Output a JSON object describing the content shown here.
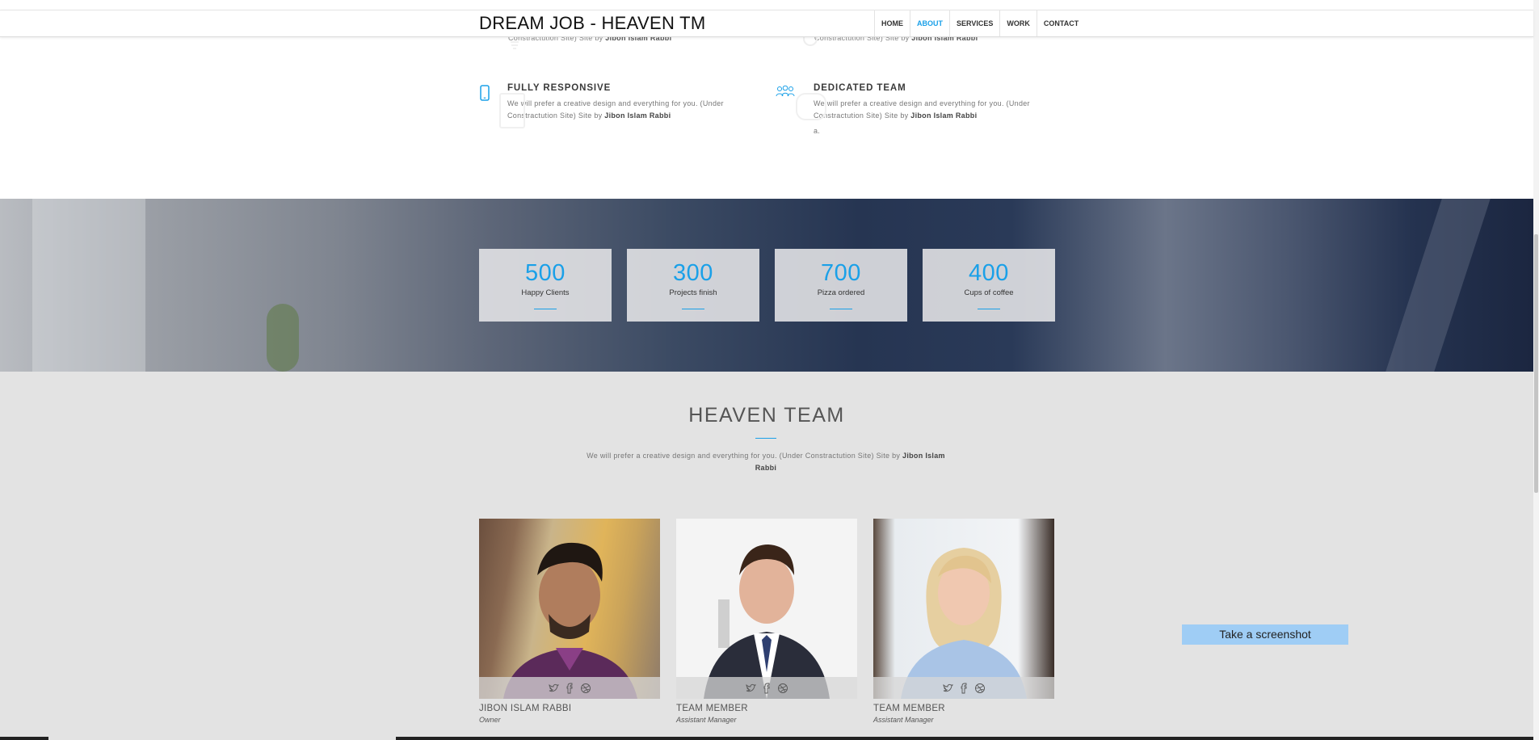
{
  "brand": "DREAM JOB - HEAVEN TM",
  "nav": [
    {
      "label": "HOME",
      "active": false
    },
    {
      "label": "ABOUT",
      "active": true
    },
    {
      "label": "SERVICES",
      "active": false
    },
    {
      "label": "WORK",
      "active": false
    },
    {
      "label": "CONTACT",
      "active": false
    }
  ],
  "features": {
    "partial_text_prefix": "Constractution Site) Site by ",
    "partial_author": "Jibon Islam Rabbi",
    "items": [
      {
        "title": "FULLY RESPONSIVE",
        "text": "We will prefer a creative design and everything for you. (Under Constractution Site) Site by ",
        "author": "Jibon Islam Rabbi",
        "icon": "mobile-icon"
      },
      {
        "title": "DEDICATED TEAM",
        "text": "We will prefer a creative design and everything for you. (Under Constractution Site) Site by ",
        "author": "Jibon Islam Rabbi",
        "icon": "team-icon",
        "extra": "a."
      }
    ]
  },
  "stats": [
    {
      "value": "500",
      "label": "Happy Clients"
    },
    {
      "value": "300",
      "label": "Projects finish"
    },
    {
      "value": "700",
      "label": "Pizza ordered"
    },
    {
      "value": "400",
      "label": "Cups of coffee"
    }
  ],
  "team": {
    "title": "HEAVEN TEAM",
    "desc": "We will prefer a creative design and everything for you. (Under Constractution Site) Site by ",
    "author": "Jibon Islam Rabbi",
    "members": [
      {
        "name": "JIBON ISLAM RABBI",
        "role": "Owner"
      },
      {
        "name": "TEAM MEMBER",
        "role": "Assistant Manager"
      },
      {
        "name": "TEAM MEMBER",
        "role": "Assistant Manager"
      }
    ],
    "social_icons": [
      "twitter-icon",
      "facebook-icon",
      "dribbble-icon"
    ]
  },
  "screenshot_button": "Take a screenshot",
  "colors": {
    "accent": "#1aa0e8",
    "team_bg": "#e3e3e3"
  }
}
